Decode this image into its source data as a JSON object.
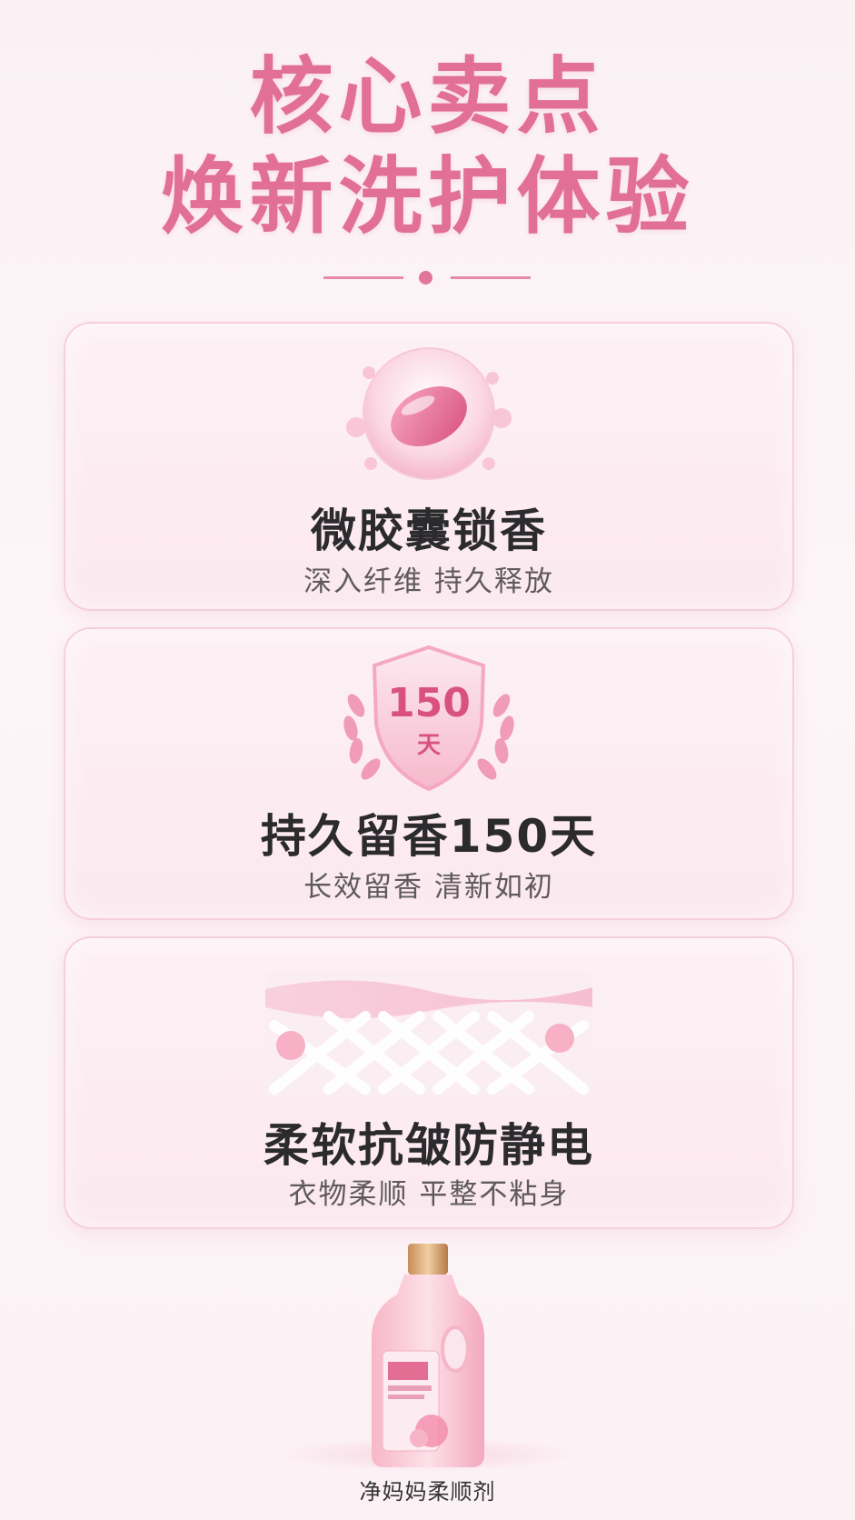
{
  "header": {
    "title_line1": "核心卖点",
    "title_line2": "焕新洗护体验"
  },
  "features": [
    {
      "title": "微胶囊锁香",
      "subtitle": "深入纤维 持久释放",
      "icon": "capsule-icon"
    },
    {
      "title": "持久留香150天",
      "subtitle": "长效留香 清新如初",
      "icon": "shield-laurel-icon",
      "badge_number": "150",
      "badge_unit": "天"
    },
    {
      "title": "柔软抗皱防静电",
      "subtitle": "衣物柔顺 平整不粘身",
      "icon": "fabric-weave-icon"
    }
  ],
  "product": {
    "name": "净妈妈柔顺剂",
    "icon": "bottle-icon"
  },
  "colors": {
    "accent": "#e26f95",
    "card_border": "#f6cfdc",
    "text_dark": "#2b2a2d",
    "text_sub": "#5e5a5c"
  }
}
